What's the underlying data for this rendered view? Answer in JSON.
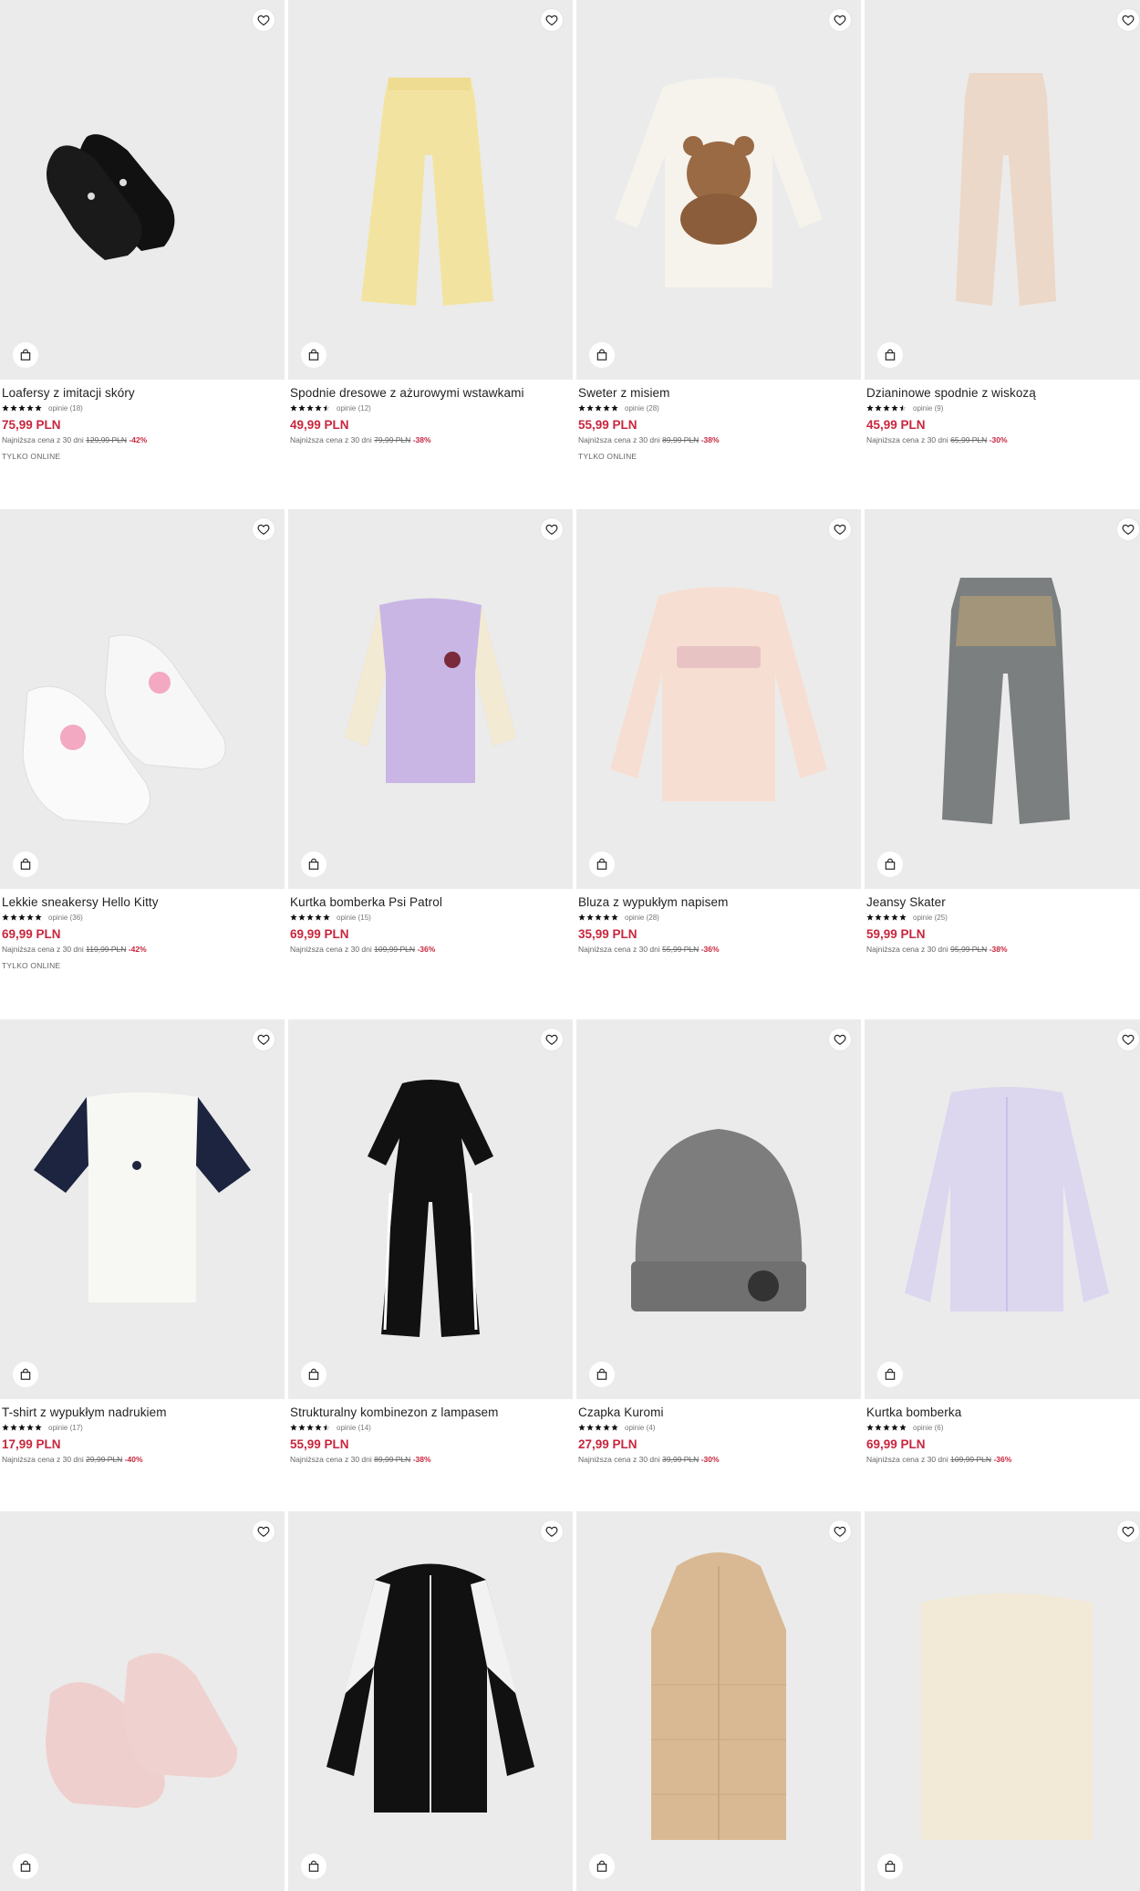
{
  "colors": {
    "price": "#c8263d",
    "image_bg": "#ebebeb"
  },
  "icons": {
    "favorite": "heart-icon",
    "cart": "shopping-bag-icon",
    "rating": "star-icon"
  },
  "products": [
    {
      "name": "Loafersy z imitacji skóry",
      "rating": 5,
      "reviews": "opinie (18)",
      "price": "75,99 PLN",
      "lowest_label": "Najniższa cena z 30 dni",
      "old_price": "129,99 PLN",
      "discount": "-42%",
      "badge": "TYLKO ONLINE"
    },
    {
      "name": "Spodnie dresowe z ażurowymi wstawkami",
      "rating": 4.5,
      "reviews": "opinie (12)",
      "price": "49,99 PLN",
      "lowest_label": "Najniższa cena z 30 dni",
      "old_price": "79,99 PLN",
      "discount": "-38%",
      "badge": ""
    },
    {
      "name": "Sweter z misiem",
      "rating": 5,
      "reviews": "opinie (28)",
      "price": "55,99 PLN",
      "lowest_label": "Najniższa cena z 30 dni",
      "old_price": "89,99 PLN",
      "discount": "-38%",
      "badge": "TYLKO ONLINE"
    },
    {
      "name": "Dzianinowe spodnie z wiskozą",
      "rating": 4.5,
      "reviews": "opinie (9)",
      "price": "45,99 PLN",
      "lowest_label": "Najniższa cena z 30 dni",
      "old_price": "65,99 PLN",
      "discount": "-30%",
      "badge": ""
    },
    {
      "name": "Lekkie sneakersy Hello Kitty",
      "rating": 5,
      "reviews": "opinie (36)",
      "price": "69,99 PLN",
      "lowest_label": "Najniższa cena z 30 dni",
      "old_price": "119,99 PLN",
      "discount": "-42%",
      "badge": "TYLKO ONLINE"
    },
    {
      "name": "Kurtka bomberka Psi Patrol",
      "rating": 5,
      "reviews": "opinie (15)",
      "price": "69,99 PLN",
      "lowest_label": "Najniższa cena z 30 dni",
      "old_price": "109,99 PLN",
      "discount": "-36%",
      "badge": ""
    },
    {
      "name": "Bluza z wypukłym napisem",
      "rating": 5,
      "reviews": "opinie (28)",
      "price": "35,99 PLN",
      "lowest_label": "Najniższa cena z 30 dni",
      "old_price": "55,99 PLN",
      "discount": "-36%",
      "badge": ""
    },
    {
      "name": "Jeansy Skater",
      "rating": 5,
      "reviews": "opinie (25)",
      "price": "59,99 PLN",
      "lowest_label": "Najniższa cena z 30 dni",
      "old_price": "95,99 PLN",
      "discount": "-38%",
      "badge": ""
    },
    {
      "name": "T-shirt z wypukłym nadrukiem",
      "rating": 5,
      "reviews": "opinie (17)",
      "price": "17,99 PLN",
      "lowest_label": "Najniższa cena z 30 dni",
      "old_price": "29,99 PLN",
      "discount": "-40%",
      "badge": ""
    },
    {
      "name": "Strukturalny kombinezon z lampasem",
      "rating": 4.5,
      "reviews": "opinie (14)",
      "price": "55,99 PLN",
      "lowest_label": "Najniższa cena z 30 dni",
      "old_price": "89,99 PLN",
      "discount": "-38%",
      "badge": ""
    },
    {
      "name": "Czapka Kuromi",
      "rating": 5,
      "reviews": "opinie (4)",
      "price": "27,99 PLN",
      "lowest_label": "Najniższa cena z 30 dni",
      "old_price": "39,99 PLN",
      "discount": "-30%",
      "badge": ""
    },
    {
      "name": "Kurtka bomberka",
      "rating": 5,
      "reviews": "opinie (6)",
      "price": "69,99 PLN",
      "lowest_label": "Najniższa cena z 30 dni",
      "old_price": "109,99 PLN",
      "discount": "-36%",
      "badge": ""
    },
    {
      "name": "",
      "rating": 0,
      "reviews": "",
      "price": "",
      "lowest_label": "",
      "old_price": "",
      "discount": "",
      "badge": ""
    },
    {
      "name": "",
      "rating": 0,
      "reviews": "",
      "price": "",
      "lowest_label": "",
      "old_price": "",
      "discount": "",
      "badge": ""
    },
    {
      "name": "",
      "rating": 0,
      "reviews": "",
      "price": "",
      "lowest_label": "",
      "old_price": "",
      "discount": "",
      "badge": ""
    },
    {
      "name": "",
      "rating": 0,
      "reviews": "",
      "price": "",
      "lowest_label": "",
      "old_price": "",
      "discount": "",
      "badge": ""
    }
  ]
}
